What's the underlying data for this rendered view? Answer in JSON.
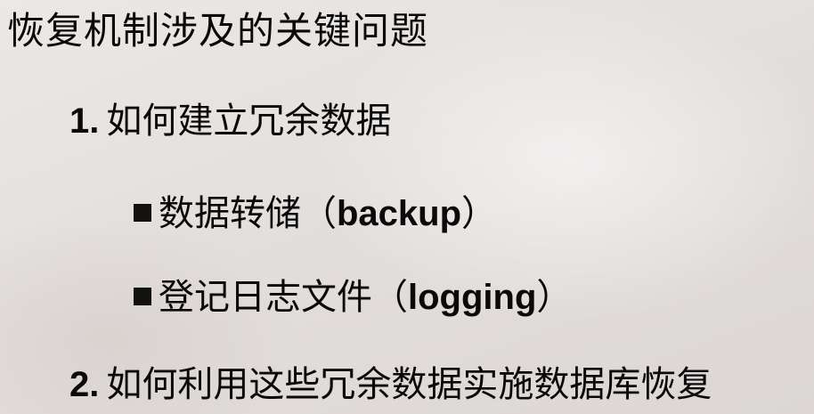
{
  "title": "恢复机制涉及的关键问题",
  "items": [
    {
      "number": "1.",
      "text": "如何建立冗余数据",
      "subitems": [
        {
          "text_cn": "数据转储",
          "paren_open": "（",
          "text_en": "backup",
          "paren_close": "）"
        },
        {
          "text_cn": "登记日志文件",
          "paren_open": "（",
          "text_en": "logging",
          "paren_close": "）"
        }
      ]
    },
    {
      "number": "2.",
      "text": "如何利用这些冗余数据实施数据库恢复"
    }
  ],
  "icons": {
    "bullet": "square-bullet-icon"
  }
}
